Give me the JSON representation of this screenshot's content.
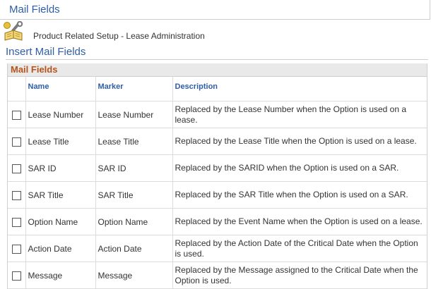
{
  "header": {
    "title": "Mail Fields"
  },
  "breadcrumb": {
    "icon": "book-wrench-icon",
    "text": "Product Related Setup - Lease Administration"
  },
  "section": {
    "title": "Insert Mail Fields"
  },
  "grid": {
    "title": "Mail Fields",
    "columns": {
      "name": "Name",
      "marker": "Marker",
      "description": "Description"
    },
    "rows": [
      {
        "name": "Lease Number",
        "marker": "Lease Number",
        "description": "Replaced by the Lease Number when the Option is used on a lease.",
        "checked": false
      },
      {
        "name": "Lease Title",
        "marker": "Lease Title",
        "description": "Replaced by the Lease Title when the Option is used on a lease.",
        "checked": false
      },
      {
        "name": "SAR ID",
        "marker": "SAR ID",
        "description": "Replaced by the SARID when the Option is used on a SAR.",
        "checked": false
      },
      {
        "name": "SAR Title",
        "marker": "SAR Title",
        "description": "Replaced by the SAR Title when the Option is used on a SAR.",
        "checked": false
      },
      {
        "name": "Option Name",
        "marker": "Option Name",
        "description": "Replaced by the Event Name when the Option is used on a lease.",
        "checked": false
      },
      {
        "name": "Action Date",
        "marker": "Action Date",
        "description": "Replaced by the Action Date of the Critical Date when the Option is used.",
        "checked": false
      },
      {
        "name": "Message",
        "marker": "Message",
        "description": "Replaced by the Message assigned to the Critical Date when the Option is used.",
        "checked": false
      }
    ]
  },
  "colors": {
    "link_blue": "#2f5ea6",
    "grid_title": "#b5541a",
    "grid_header_bg": "#e9e9e9"
  }
}
